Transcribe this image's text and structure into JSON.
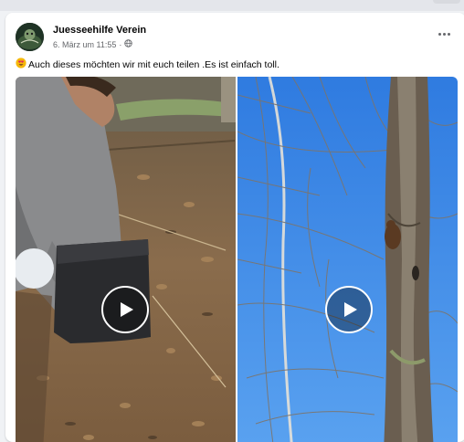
{
  "post": {
    "author": "Juesseehilfe Verein",
    "date": "6. März um 11:55",
    "separator": "·",
    "audience_icon": "globe-icon",
    "text": "Auch dieses möchten wir mit euch teilen .Es ist einfach toll.",
    "emoji_icon": "heart-eyes-emoji-icon",
    "more_icon": "more-options-icon"
  },
  "media": {
    "videos": [
      {
        "name": "video-leaves-box",
        "play_icon": "play-icon"
      },
      {
        "name": "video-tree-squirrel",
        "play_icon": "play-icon"
      }
    ]
  },
  "colors": {
    "text_primary": "#050505",
    "text_secondary": "#65676b",
    "sky": "#3f8ae6",
    "card_bg": "#ffffff",
    "page_bg": "#f0f2f5"
  }
}
